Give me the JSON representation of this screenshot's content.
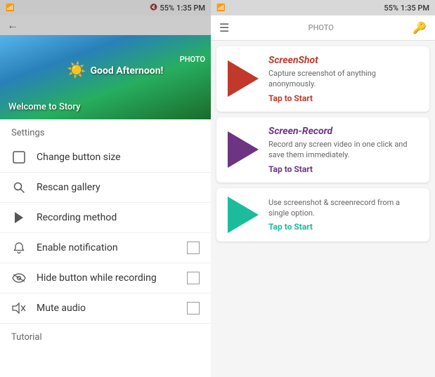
{
  "left_panel": {
    "status_bar": {
      "time": "1:35 PM",
      "battery": "55%"
    },
    "hero": {
      "greeting": "Good Afternoon!",
      "photo_label": "PHOTO",
      "welcome_text": "Welcome to Story"
    },
    "settings_label": "Settings",
    "menu_items": [
      {
        "id": "change-button-size",
        "label": "Change button size",
        "icon": "⬜",
        "has_checkbox": false
      },
      {
        "id": "rescan-gallery",
        "label": "Rescan gallery",
        "icon": "🔍",
        "has_checkbox": false
      },
      {
        "id": "recording-method",
        "label": "Recording method",
        "icon": "▶",
        "has_checkbox": false
      },
      {
        "id": "enable-notification",
        "label": "Enable notification",
        "icon": "🔔",
        "has_checkbox": true
      },
      {
        "id": "hide-button",
        "label": "Hide button while recording",
        "icon": "👁",
        "has_checkbox": true
      },
      {
        "id": "mute-audio",
        "label": "Mute audio",
        "icon": "🔇",
        "has_checkbox": true
      }
    ],
    "tutorial_label": "Tutorial"
  },
  "right_panel": {
    "status_bar": {
      "time": "1:35 PM",
      "battery": "55%"
    },
    "photo_label": "PHOTO",
    "key_icon": "🔑",
    "cards": [
      {
        "id": "screenshot",
        "title": "ScreenShot",
        "title_color": "red",
        "arrow_color": "red",
        "description": "Capture screenshot of anything anonymously.",
        "tap_label": "Tap to Start",
        "tap_color": "red"
      },
      {
        "id": "screen-record",
        "title": "Screen-Record",
        "title_color": "purple",
        "arrow_color": "purple",
        "description": "Record any screen video in one click and save them immediately.",
        "tap_label": "Tap to Start",
        "tap_color": "purple"
      },
      {
        "id": "combo",
        "title": "",
        "title_color": "cyan",
        "arrow_color": "cyan",
        "description": "Use screenshot & screenrecord from a single option.",
        "tap_label": "Tap to Start",
        "tap_color": "cyan"
      }
    ]
  }
}
